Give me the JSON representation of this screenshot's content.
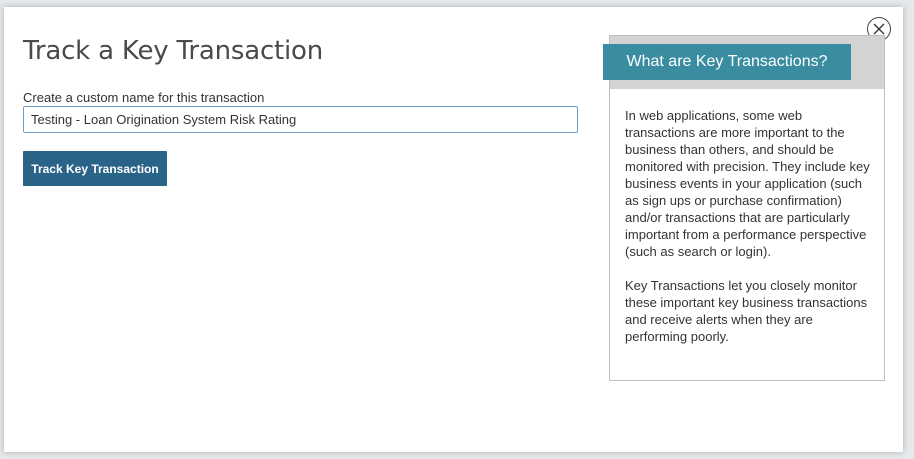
{
  "dialog": {
    "title": "Track a Key Transaction",
    "close_icon": "close-icon",
    "name_field": {
      "label": "Create a custom name for this transaction",
      "value": "Testing - Loan Origination System Risk Rating",
      "placeholder": ""
    },
    "track_button_label": "Track Key Transaction",
    "info": {
      "heading": "What are Key Transactions?",
      "paragraphs": [
        "In web applications, some web transactions are more important to the business than others, and should be monitored with precision. They include key business events in your application (such as sign ups or purchase confirmation) and/or transactions that are particularly important from a performance perspective (such as search or login).",
        "Key Transactions let you closely monitor these important key business transactions and receive alerts when they are performing poorly."
      ]
    }
  },
  "colors": {
    "primary_button": "#2a6388",
    "info_tab": "#3a8da1",
    "input_border": "#6d9cc5"
  }
}
